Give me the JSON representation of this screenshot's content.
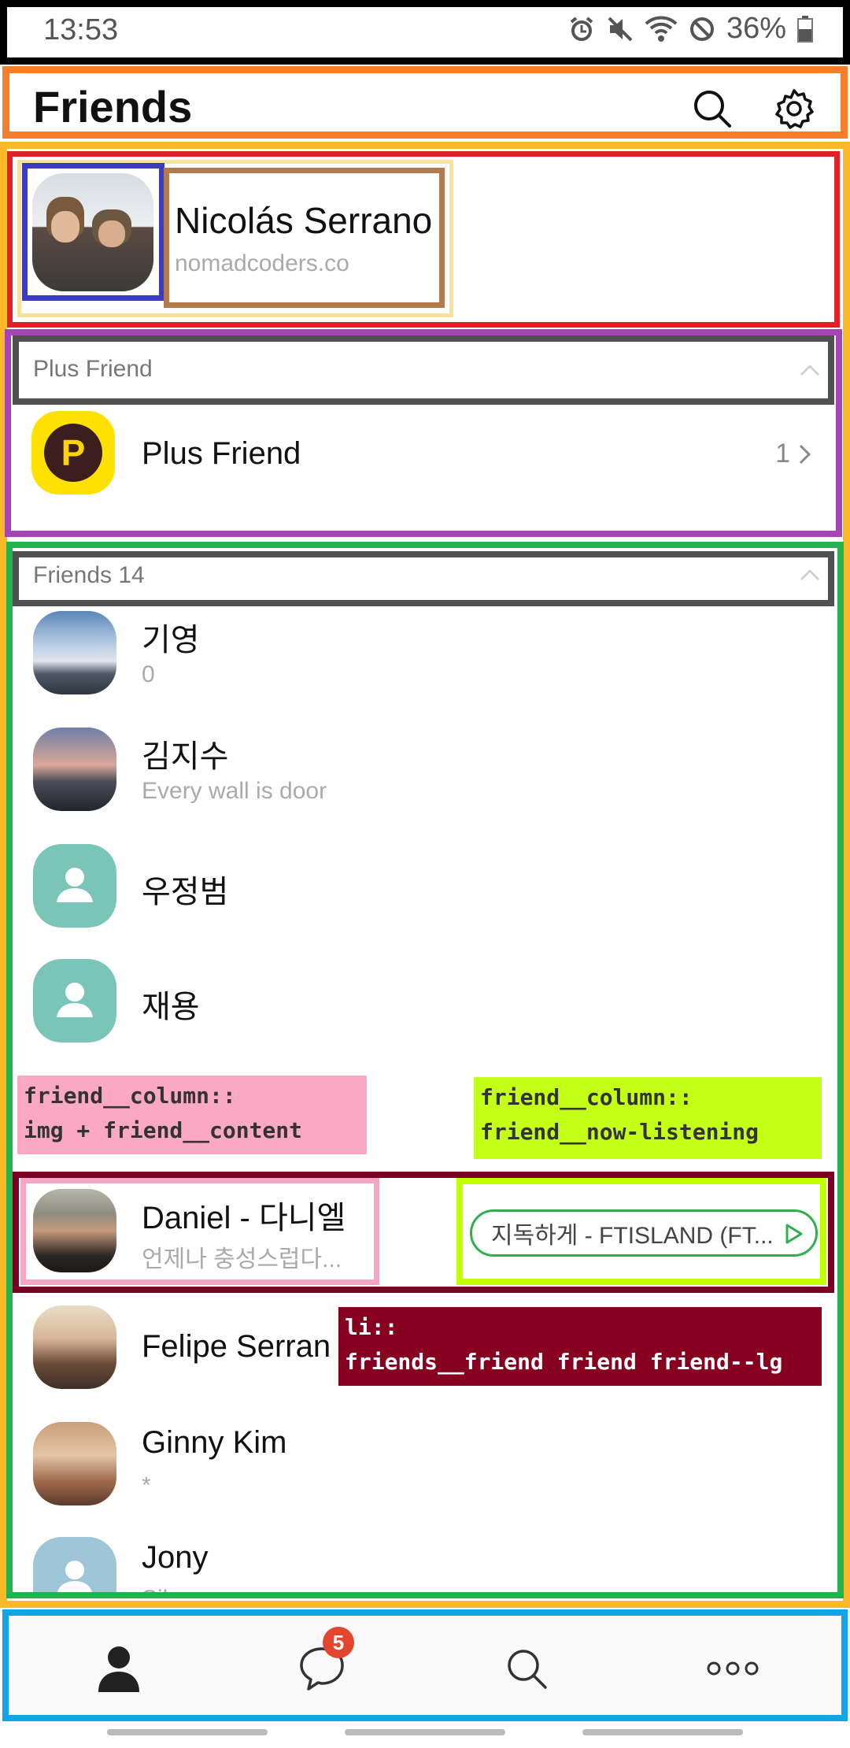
{
  "status_bar": {
    "time": "13:53",
    "battery": "36%"
  },
  "header": {
    "title": "Friends",
    "search_icon": "search-icon",
    "settings_icon": "gear-icon"
  },
  "profile": {
    "name": "Nicolás Serrano",
    "subtitle": "nomadcoders.co"
  },
  "plus_section": {
    "header": "Plus Friend",
    "item": {
      "name": "Plus Friend",
      "count": "1"
    }
  },
  "friends_section": {
    "header": "Friends 14",
    "friends": [
      {
        "name": "기영",
        "status": "0"
      },
      {
        "name": "김지수",
        "status": "Every wall is door"
      },
      {
        "name": "우정범",
        "status": ""
      },
      {
        "name": "재용",
        "status": ""
      },
      {
        "name": "Daniel - 다니엘",
        "status": "언제나 충성스럽다...",
        "now_listening": "지독하게 - FTISLAND (FT..."
      },
      {
        "name": "Felipe Serran",
        "status": ""
      },
      {
        "name": "Ginny Kim",
        "status": "*"
      },
      {
        "name": "Jony",
        "status": "Silence"
      }
    ]
  },
  "annotations": {
    "column_line1": "friend__column::",
    "column_line2": "img + friend__content",
    "listening_line1": "friend__column::",
    "listening_line2": "friend__now-listening",
    "li_line1": "li::",
    "li_line2": "friends__friend friend friend--lg"
  },
  "bottom_nav": {
    "chats_badge": "5"
  },
  "colors": {
    "status_border": "#000000",
    "header_border": "#f47e2a",
    "main_border": "#fbb829",
    "profile_border": "#e21f25",
    "plus_border": "#a444b5",
    "friends_border": "#22b14c",
    "nav_border": "#12a4e6",
    "listening_green": "#2fb04d",
    "badge_red": "#e2462f"
  }
}
